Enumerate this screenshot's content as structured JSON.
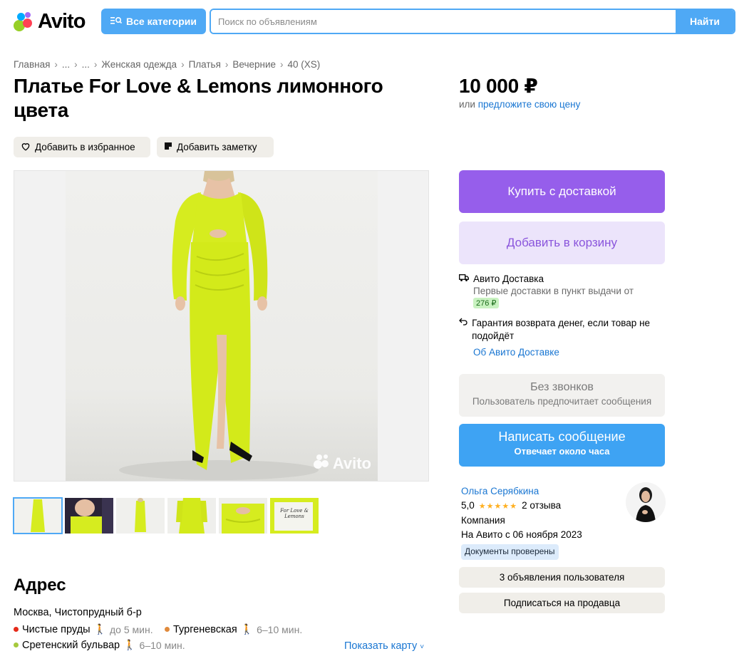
{
  "header": {
    "logo_text": "Avito",
    "categories_label": "Все категории",
    "search_placeholder": "Поиск по объявлениям",
    "search_button": "Найти"
  },
  "breadcrumb": [
    "Главная",
    "...",
    "...",
    "Женская одежда",
    "Платья",
    "Вечерние",
    "40 (XS)"
  ],
  "listing": {
    "title": "Платье For Love & Lemons лимонного цвета",
    "price": "10 000 ₽",
    "price_or": "или",
    "price_offer_link": "предложите свою цену",
    "favorite_label": "Добавить в избранное",
    "note_label": "Добавить заметку",
    "watermark": "Avito",
    "thumbnail_label_text": "For Love & Lemons"
  },
  "actions": {
    "buy_label": "Купить с доставкой",
    "cart_label": "Добавить в корзину"
  },
  "delivery": {
    "title": "Авито Доставка",
    "first_text": "Первые доставки в пункт выдачи от",
    "first_price": "276 ₽",
    "guarantee": "Гарантия возврата денег, если товар не подойдёт",
    "about_link": "Об Авито Доставке"
  },
  "contact": {
    "no_calls_title": "Без звонков",
    "no_calls_sub": "Пользователь предпочитает сообщения",
    "message_label": "Написать сообщение",
    "message_sub": "Отвечает около часа"
  },
  "seller": {
    "name": "Ольга Серябкина",
    "rating": "5,0",
    "stars": "★★★★★",
    "reviews": "2 отзыва",
    "type": "Компания",
    "since": "На Авито с 06 ноября 2023",
    "verified": "Документы проверены",
    "listings_label": "3 объявления пользователя",
    "subscribe_label": "Подписаться на продавца"
  },
  "address": {
    "title": "Адрес",
    "line": "Москва, Чистопрудный б-р",
    "metro": [
      {
        "name": "Чистые пруды",
        "walk": "до 5 мин.",
        "color": "#e52b1a"
      },
      {
        "name": "Тургеневская",
        "walk": "6–10 мин.",
        "color": "#e08a3c"
      },
      {
        "name": "Сретенский бульвар",
        "walk": "6–10 мин.",
        "color": "#a6c93d"
      }
    ],
    "show_map": "Показать карту"
  },
  "colors": {
    "accent_blue": "#4fa9f5",
    "buy_purple": "#965eeb",
    "cart_lavender": "#ece4fb",
    "dress_lime": "#d6ec1f"
  }
}
